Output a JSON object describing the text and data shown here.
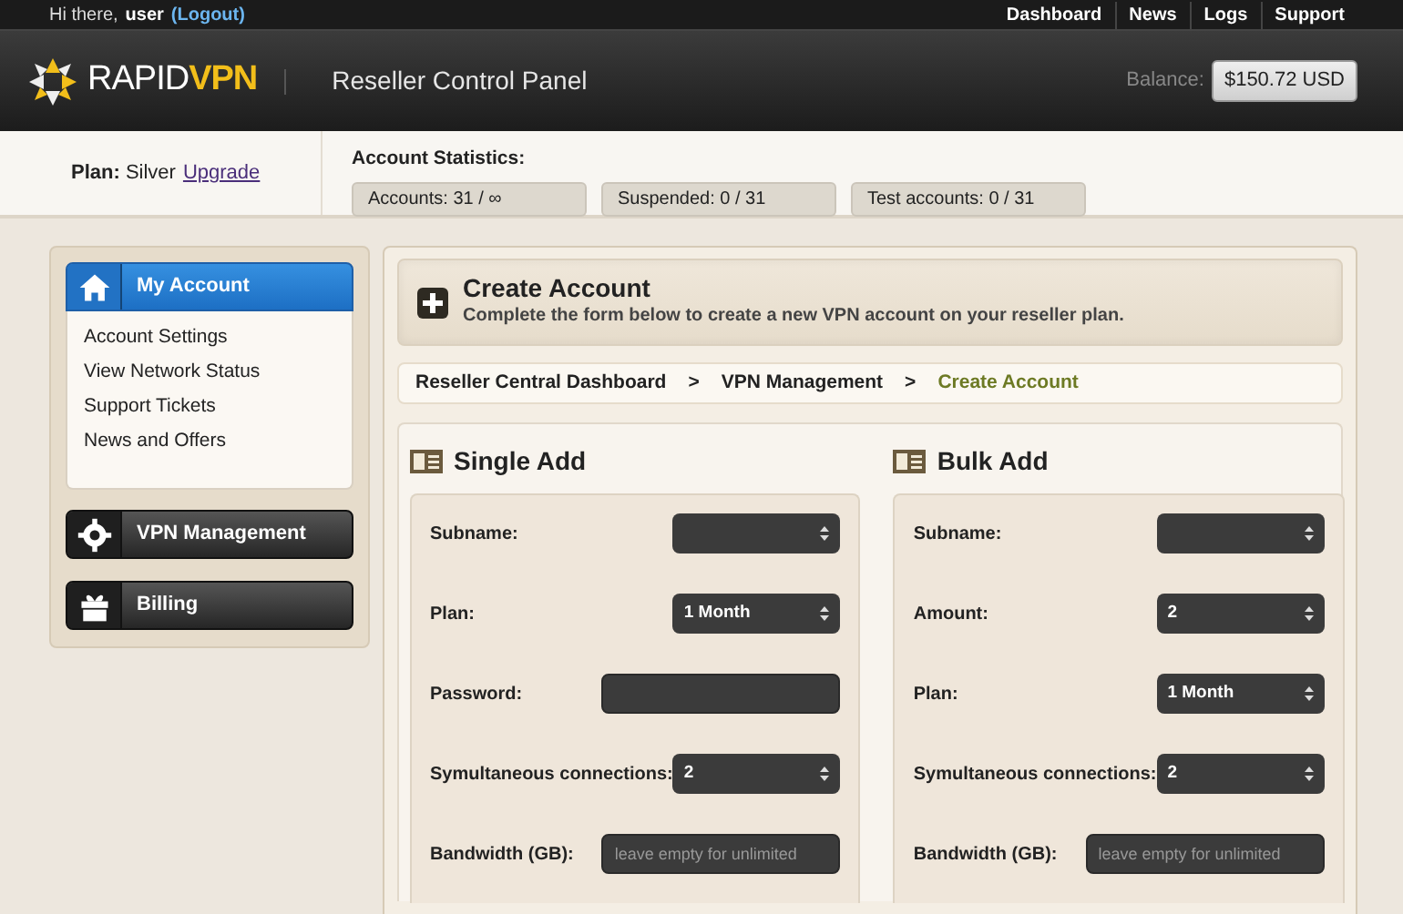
{
  "top_bar": {
    "greeting": "Hi there,",
    "user": "user",
    "logout": "(Logout)",
    "links": [
      "Dashboard",
      "News",
      "Logs",
      "Support"
    ]
  },
  "header": {
    "logo_primary": "RAPID",
    "logo_accent": "VPN",
    "title": "Reseller Control Panel",
    "balance_label": "Balance:",
    "balance": "$150.72 USD"
  },
  "plan": {
    "label": "Plan:",
    "value": "Silver",
    "upgrade": "Upgrade"
  },
  "stats": {
    "title": "Account Statistics:",
    "items": [
      "Accounts: 31 / ∞",
      "Suspended: 0 / 31",
      "Test accounts: 0 / 31"
    ]
  },
  "sidebar": [
    {
      "label": "My Account",
      "selected": true,
      "expanded": true,
      "items": [
        "Account Settings",
        "View Network Status",
        "Support Tickets",
        "News and Offers"
      ]
    },
    {
      "label": "VPN Management",
      "selected": false,
      "expanded": false
    },
    {
      "label": "Billing",
      "selected": false,
      "expanded": false
    }
  ],
  "page_header": {
    "title": "Create Account",
    "subtitle": "Complete the form below to create a new VPN account on your reseller plan."
  },
  "breadcrumb": {
    "separators": [
      ">",
      ">"
    ],
    "items": [
      {
        "label": "Reseller Central Dashboard",
        "selected": false
      },
      {
        "label": "VPN Management",
        "selected": false
      },
      {
        "label": "Create Account",
        "selected": true
      }
    ]
  },
  "forms": [
    {
      "title": "Single Add",
      "fields": [
        {
          "label": "Subname:",
          "kind": "select"
        },
        {
          "label": "Plan:",
          "kind": "select",
          "value": "1 Month"
        },
        {
          "label": "Password:",
          "kind": "input"
        },
        {
          "label": "Symultaneous connections:",
          "kind": "select",
          "value": "2"
        },
        {
          "label": "Bandwidth (GB):",
          "kind": "input",
          "placeholder": "leave empty for unlimited"
        }
      ]
    },
    {
      "title": "Bulk Add",
      "fields": [
        {
          "label": "Subname:",
          "kind": "select"
        },
        {
          "label": "Amount:",
          "kind": "select",
          "value": "2"
        },
        {
          "label": "Plan:",
          "kind": "select",
          "value": "1 Month"
        },
        {
          "label": "Symultaneous connections:",
          "kind": "select",
          "value": "2"
        },
        {
          "label": "Bandwidth (GB):",
          "kind": "input",
          "placeholder": "leave empty for unlimited"
        }
      ]
    }
  ]
}
